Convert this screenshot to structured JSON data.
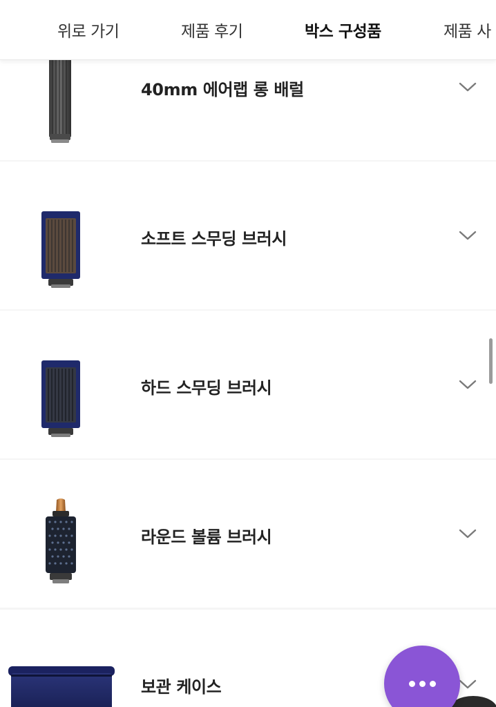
{
  "tabs": [
    {
      "label": "위로 가기",
      "active": false
    },
    {
      "label": "제품 후기",
      "active": false
    },
    {
      "label": "박스 구성품",
      "active": true
    },
    {
      "label": "제품 사",
      "active": false
    }
  ],
  "items": [
    {
      "label": "40mm 에어랩 롱 배럴",
      "icon": "long-barrel-image"
    },
    {
      "label": "소프트 스무딩 브러시",
      "icon": "soft-smoothing-brush-image"
    },
    {
      "label": "하드 스무딩 브러시",
      "icon": "hard-smoothing-brush-image"
    },
    {
      "label": "라운드 볼륨 브러시",
      "icon": "round-volume-brush-image"
    },
    {
      "label": "보관 케이스",
      "icon": "storage-case-image"
    }
  ],
  "fab": {
    "icon": "more-dots-icon"
  },
  "colors": {
    "accent": "#8a55d6",
    "navy": "#1f2a6b",
    "copper": "#c27c3e",
    "text": "#222222"
  }
}
